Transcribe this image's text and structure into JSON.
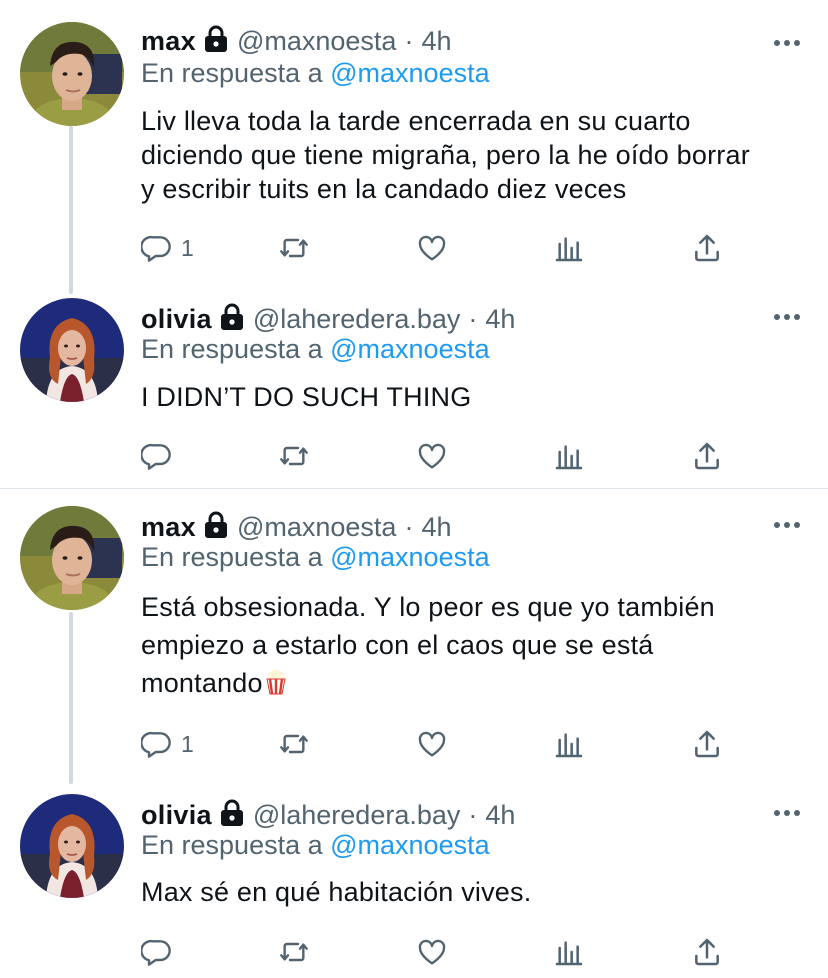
{
  "tweets": [
    {
      "name": "max",
      "handle": "@maxnoesta",
      "sep": "·",
      "time": "4h",
      "reply_prefix": "En respuesta a ",
      "reply_mention": "@maxnoesta",
      "text": "Liv lleva toda la tarde encerrada en su cuarto\ndiciendo que tiene migraña, pero la he oído borrar\ny escribir tuits en la candado diez veces",
      "reply_count": "1",
      "avatar": "max"
    },
    {
      "name": "olivia",
      "handle": "@laheredera.bay",
      "sep": "·",
      "time": "4h",
      "reply_prefix": "En respuesta a ",
      "reply_mention": "@maxnoesta",
      "text": "I DIDN’T DO SUCH THING",
      "reply_count": "",
      "avatar": "olivia"
    },
    {
      "name": "max",
      "handle": "@maxnoesta",
      "sep": "·",
      "time": "4h",
      "reply_prefix": "En respuesta a ",
      "reply_mention": "@maxnoesta",
      "text": "Está obsesionada. Y lo peor es que yo también\nempiezo a estarlo con el caos que se está\nmontando",
      "reply_count": "1",
      "avatar": "max"
    },
    {
      "name": "olivia",
      "handle": "@laheredera.bay",
      "sep": "·",
      "time": "4h",
      "reply_prefix": "En respuesta a ",
      "reply_mention": "@maxnoesta",
      "text": "Max sé en qué habitación vives.",
      "reply_count": "",
      "avatar": "olivia"
    }
  ],
  "icons": {
    "lock": "lock-icon",
    "more": "more-icon",
    "reply": "reply-icon",
    "retweet": "retweet-icon",
    "like": "heart-icon",
    "analytics": "analytics-icon",
    "share": "share-icon",
    "emoji": "popcorn-emoji"
  },
  "colors": {
    "mention": "#1d9bf0",
    "secondary": "#536471",
    "primary": "#0f1419",
    "thread_line": "#cfd9de"
  }
}
